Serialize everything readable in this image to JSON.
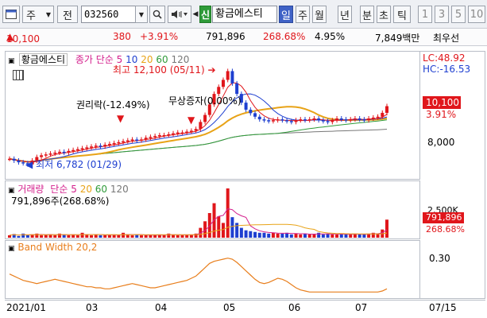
{
  "toolbar": {
    "market": "주",
    "period_type": "전",
    "code": "032560",
    "new_badge": "신",
    "name": "황금에스티",
    "periods": [
      "일",
      "주",
      "월",
      "년",
      "분",
      "초",
      "틱"
    ],
    "active_period": "일",
    "numbers": [
      "1",
      "3",
      "5",
      "10"
    ]
  },
  "quote": {
    "price": "10,100",
    "change": "380",
    "change_pct": "+3.91%",
    "volume": "791,896",
    "volume_ratio": "268.68%",
    "turnover": "4.95%",
    "amount": "7,849백만",
    "broker": "최우선"
  },
  "price_panel": {
    "stock_name": "황금에스티",
    "ma_label": "종가 단순",
    "ma_periods": [
      "5",
      "10",
      "20",
      "60",
      "120"
    ],
    "ma_colors": [
      "#e0161b",
      "#1e3fd0",
      "#e8a317",
      "#2f9b39",
      "#777777"
    ],
    "high_label": "최고 12,100 (05/11)",
    "low_label": "최저 6,782 (01/29)",
    "event1": "권리락(-12.49%)",
    "event2": "무상증자(0.00%)",
    "lc": "LC:48.92",
    "hc": "HC:-16.53",
    "price_box": "10,100",
    "price_pct": "3.91%",
    "axis_tick": "8,000"
  },
  "volume_panel": {
    "label": "거래량",
    "ma_label": "단순",
    "ma_periods": [
      "5",
      "20",
      "60",
      "120"
    ],
    "value": "791,896주(268.68%)",
    "axis_tick": "2,500K",
    "box_value": "791,896",
    "box_pct": "268.68%"
  },
  "bw_panel": {
    "label": "Band Width 20,2",
    "axis_tick": "0.30"
  },
  "x_axis": {
    "labels": [
      "2021/01",
      "03",
      "04",
      "05",
      "06",
      "07"
    ],
    "right_label": "07/15"
  },
  "chart_data": {
    "type": "line",
    "close": [
      7100,
      7000,
      6900,
      6850,
      6782,
      7000,
      7200,
      7300,
      7350,
      7400,
      7450,
      7500,
      7450,
      7550,
      7600,
      7650,
      7700,
      7750,
      7800,
      7850,
      7800,
      7900,
      7950,
      8000,
      8050,
      8100,
      8150,
      8200,
      8150,
      8200,
      8300,
      8350,
      8400,
      8450,
      8450,
      8500,
      8550,
      8600,
      8600,
      8650,
      8700,
      8800,
      9200,
      9600,
      10200,
      10800,
      11200,
      11600,
      12100,
      11400,
      10800,
      10300,
      9900,
      9700,
      9500,
      9350,
      9300,
      9250,
      9300,
      9350,
      9300,
      9250,
      9200,
      9300,
      9350,
      9300,
      9350,
      9400,
      9300,
      9250,
      9200,
      9300,
      9400,
      9350,
      9300,
      9350,
      9400,
      9350,
      9300,
      9400,
      9450,
      9500,
      9720,
      10100
    ],
    "volume": [
      0.3,
      0.45,
      0.2,
      0.5,
      0.3,
      0.4,
      0.5,
      0.3,
      0.35,
      0.4,
      0.3,
      0.5,
      0.35,
      0.3,
      0.4,
      0.3,
      0.6,
      0.35,
      0.3,
      0.4,
      0.3,
      0.35,
      0.3,
      0.4,
      0.3,
      0.6,
      0.35,
      0.3,
      0.4,
      0.3,
      0.3,
      0.35,
      0.3,
      0.4,
      0.3,
      0.5,
      0.35,
      0.3,
      0.3,
      0.35,
      0.4,
      0.5,
      1.2,
      2.0,
      3.0,
      4.2,
      2.6,
      1.8,
      6.0,
      2.5,
      1.8,
      1.2,
      0.9,
      0.8,
      0.7,
      0.6,
      0.6,
      0.5,
      0.6,
      0.5,
      0.5,
      0.6,
      0.4,
      0.5,
      0.4,
      0.5,
      0.4,
      0.4,
      0.6,
      0.4,
      0.5,
      0.4,
      0.4,
      0.5,
      0.4,
      0.4,
      0.5,
      0.4,
      0.4,
      0.5,
      0.6,
      0.5,
      1.0,
      2.2
    ],
    "bandwidth": [
      0.22,
      0.2,
      0.18,
      0.16,
      0.15,
      0.14,
      0.13,
      0.14,
      0.15,
      0.16,
      0.17,
      0.16,
      0.15,
      0.14,
      0.13,
      0.12,
      0.11,
      0.1,
      0.1,
      0.09,
      0.09,
      0.08,
      0.08,
      0.09,
      0.1,
      0.11,
      0.12,
      0.13,
      0.12,
      0.11,
      0.1,
      0.09,
      0.09,
      0.1,
      0.11,
      0.12,
      0.13,
      0.14,
      0.15,
      0.16,
      0.18,
      0.2,
      0.24,
      0.28,
      0.32,
      0.34,
      0.35,
      0.36,
      0.37,
      0.36,
      0.33,
      0.29,
      0.25,
      0.21,
      0.17,
      0.14,
      0.13,
      0.14,
      0.16,
      0.18,
      0.17,
      0.15,
      0.12,
      0.09,
      0.07,
      0.06,
      0.05,
      0.05,
      0.05,
      0.05,
      0.05,
      0.05,
      0.05,
      0.05,
      0.05,
      0.05,
      0.05,
      0.05,
      0.05,
      0.05,
      0.05,
      0.05,
      0.06,
      0.08
    ],
    "ylim_price": [
      6000,
      12800
    ],
    "ylim_bw": [
      0.0,
      0.45
    ]
  }
}
